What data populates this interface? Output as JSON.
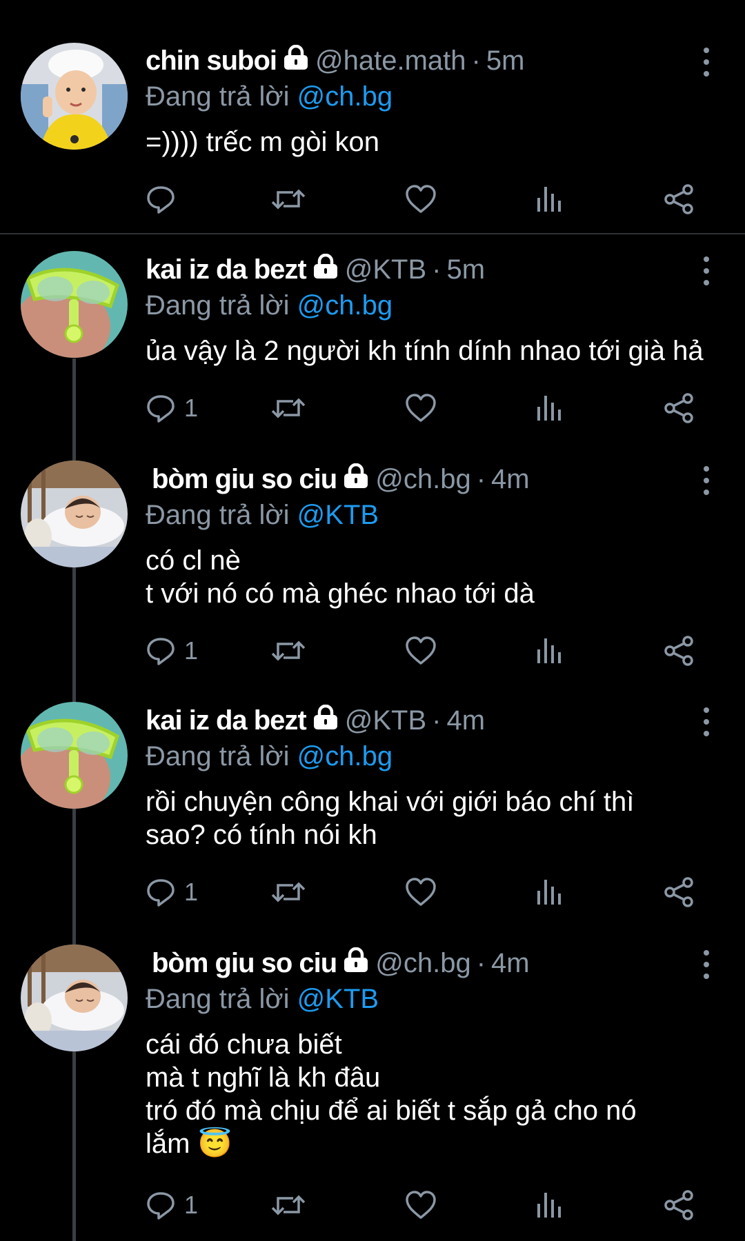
{
  "reply_prefix": "Đang trả lời",
  "tweets": [
    {
      "name": "chin suboi",
      "handle": "@hate.math",
      "time": "5m",
      "reply_to": "@ch.bg",
      "lines": [
        "=)))) trếc m gòi kon"
      ],
      "reply_count": "",
      "avatar": "boy-white-hat"
    },
    {
      "name": "kai iz da bezt",
      "handle": "@KTB",
      "time": "5m",
      "reply_to": "@ch.bg",
      "lines": [
        "ủa vậy là 2 người kh tính dính nhao tới già hả"
      ],
      "reply_count": "1",
      "avatar": "snorkel-mask"
    },
    {
      "name": "bòm giu so ciu",
      "handle": "@ch.bg",
      "time": "4m",
      "reply_to": "@KTB",
      "lines": [
        "có cl nè",
        "t với nó có mà ghéc nhao tới dà"
      ],
      "reply_count": "1",
      "avatar": "sleeping-baby"
    },
    {
      "name": "kai iz da bezt",
      "handle": "@KTB",
      "time": "4m",
      "reply_to": "@ch.bg",
      "lines": [
        "rồi chuyện công khai với giới báo chí thì",
        "sao? có tính nói kh"
      ],
      "reply_count": "1",
      "avatar": "snorkel-mask"
    },
    {
      "name": "bòm giu so ciu",
      "handle": "@ch.bg",
      "time": "4m",
      "reply_to": "@KTB",
      "lines": [
        "cái đó chưa biết",
        "mà t nghĩ là kh đâu",
        "tró đó mà chịu để ai biết t sắp gả cho nó",
        "lắm 😇"
      ],
      "reply_count": "1",
      "avatar": "sleeping-baby"
    }
  ],
  "icons": {
    "lock": "lock-icon",
    "more": "more-vertical-icon",
    "reply": "reply-icon",
    "retweet": "retweet-icon",
    "like": "heart-icon",
    "views": "analytics-icon",
    "share": "share-icon"
  },
  "colors": {
    "background": "#000000",
    "text": "#ffffff",
    "secondary": "#8b98a5",
    "link": "#1d9bf0",
    "separator": "#2f3336",
    "thread_line": "#3a3f44"
  }
}
